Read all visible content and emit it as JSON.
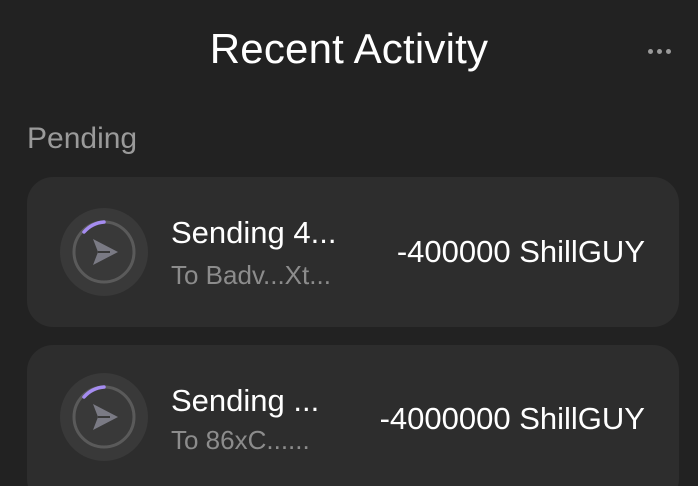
{
  "header": {
    "title": "Recent Activity",
    "menu_icon": "more-horizontal-icon"
  },
  "pending": {
    "label": "Pending",
    "items": [
      {
        "title": "Sending 4...",
        "subtitle": "To Badv...Xt...",
        "amount": "-400000 ShillGUY",
        "icon": "send-arrow-icon"
      },
      {
        "title": "Sending ...",
        "subtitle": "To 86xC......",
        "amount": "-4000000 ShillGUY",
        "icon": "send-arrow-icon"
      }
    ]
  },
  "colors": {
    "background": "#222222",
    "card": "#2d2d2d",
    "accent": "#a58cf0",
    "muted_text": "#8c8c8c"
  }
}
